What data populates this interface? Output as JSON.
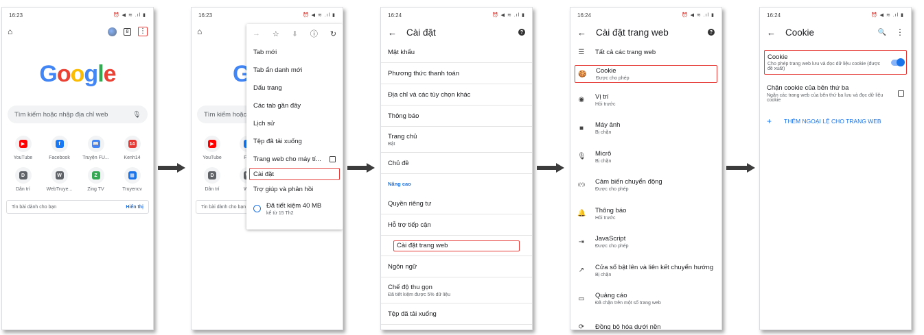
{
  "colors": {
    "accent": "#1a73e8",
    "highlight": "#e53935"
  },
  "screen1": {
    "time": "16:23",
    "status_icons": "⏰ ◀ ≋ .ıl ▮",
    "google_letters": [
      {
        "ch": "G",
        "color": "#4285f4"
      },
      {
        "ch": "o",
        "color": "#ea4335"
      },
      {
        "ch": "o",
        "color": "#fbbc05"
      },
      {
        "ch": "g",
        "color": "#4285f4"
      },
      {
        "ch": "l",
        "color": "#34a853"
      },
      {
        "ch": "e",
        "color": "#ea4335"
      }
    ],
    "tab_count": "8",
    "search_placeholder": "Tìm kiếm hoặc nhập địa chỉ web",
    "tiles": [
      {
        "label": "YouTube",
        "glyph": "▶",
        "color": "#ff0000"
      },
      {
        "label": "Facebook",
        "glyph": "f",
        "color": "#1877f2"
      },
      {
        "label": "Truyện FU...",
        "glyph": "📖",
        "color": "#4285f4"
      },
      {
        "label": "Kenh14",
        "glyph": "14",
        "color": "#e53935"
      },
      {
        "label": "Dân trí",
        "glyph": "D",
        "color": "#5f6368"
      },
      {
        "label": "WebTruye...",
        "glyph": "W",
        "color": "#5f6368"
      },
      {
        "label": "Zing TV",
        "glyph": "Z",
        "color": "#34a853"
      },
      {
        "label": "Truyencv",
        "glyph": "▦",
        "color": "#1a73e8"
      }
    ],
    "feed_label": "Tin bài dành cho bạn",
    "feed_link": "Hiển thị"
  },
  "screen2": {
    "time": "16:23",
    "status_icons": "⏰ ◀ ≋ .ıl ▮",
    "search_placeholder": "Tìm kiếm hoặc nhập",
    "tiles": [
      {
        "label": "YouTube",
        "glyph": "▶",
        "color": "#ff0000"
      },
      {
        "label": "Fac",
        "glyph": "f",
        "color": "#1877f2"
      },
      {
        "label": "Dân trí",
        "glyph": "D",
        "color": "#5f6368"
      },
      {
        "label": "Wel",
        "glyph": "W",
        "color": "#5f6368"
      }
    ],
    "feed_label": "Tin bài dành cho bạn",
    "menu": {
      "items": [
        "Tab mới",
        "Tab ẩn danh mới",
        "Dấu trang",
        "Các tab gần đây",
        "Lịch sử",
        "Tệp đã tải xuống"
      ],
      "desktop_site": "Trang web cho máy tí...",
      "settings": "Cài đặt",
      "help": "Trợ giúp và phản hồi",
      "savings_title": "Đã tiết kiệm 40 MB",
      "savings_sub": "kể từ 15 Th2"
    }
  },
  "screen3": {
    "time": "16:24",
    "status_icons": "⏰ ◀ ≋ .ıl ▮",
    "title": "Cài đặt",
    "rows_top": [
      {
        "t": "Mật khẩu"
      },
      {
        "t": "Phương thức thanh toán"
      },
      {
        "t": "Địa chỉ và các tùy chọn khác"
      },
      {
        "t": "Thông báo"
      },
      {
        "t": "Trang chủ",
        "sub": "Bật"
      },
      {
        "t": "Chủ đề"
      }
    ],
    "section": "Nâng cao",
    "rows_bottom": [
      {
        "t": "Quyền riêng tư"
      },
      {
        "t": "Hỗ trợ tiếp cận"
      }
    ],
    "site_settings": "Cài đặt trang web",
    "rows_end": [
      {
        "t": "Ngôn ngữ"
      },
      {
        "t": "Chế độ thu gọn",
        "sub": "Đã tiết kiệm được 5% dữ liệu"
      },
      {
        "t": "Tệp đã tải xuống"
      }
    ]
  },
  "screen4": {
    "time": "16:24",
    "status_icons": "⏰ ◀ ≋ .ıl ▮",
    "title": "Cài đặt trang web",
    "all_sites": "Tất cả các trang web",
    "cookie": {
      "t": "Cookie",
      "sub": "Được cho phép"
    },
    "rows": [
      {
        "icon": "◉",
        "name": "location-icon",
        "t": "Vị trí",
        "sub": "Hỏi trước"
      },
      {
        "icon": "■",
        "name": "camera-icon",
        "t": "Máy ảnh",
        "sub": "Bị chặn"
      },
      {
        "icon": "🎙",
        "name": "microphone-icon",
        "t": "Micrô",
        "sub": "Bị chặn"
      },
      {
        "icon": "((•))",
        "name": "motion-sensor-icon",
        "t": "Cảm biến chuyển động",
        "sub": "Được cho phép"
      },
      {
        "icon": "🔔",
        "name": "bell-icon",
        "t": "Thông báo",
        "sub": "Hỏi trước"
      },
      {
        "icon": "⇥",
        "name": "javascript-icon",
        "t": "JavaScript",
        "sub": "Được cho phép"
      },
      {
        "icon": "↗",
        "name": "popup-icon",
        "t": "Cửa sổ bật lên và liên kết chuyển hướng",
        "sub": "Bị chặn"
      },
      {
        "icon": "▭",
        "name": "ads-icon",
        "t": "Quảng cáo",
        "sub": "Đã chặn trên một số trang web"
      },
      {
        "icon": "⟳",
        "name": "sync-icon",
        "t": "Đồng bộ hóa dưới nền",
        "sub": ""
      }
    ]
  },
  "screen5": {
    "time": "16:24",
    "status_icons": "⏰ ◀ ≋ .ıl ▮",
    "title": "Cookie",
    "cookie_row": {
      "t": "Cookie",
      "sub": "Cho phép trang web lưu và đọc dữ liệu cookie (được đề xuất)",
      "enabled": true
    },
    "third_party": {
      "t": "Chặn cookie của bên thứ ba",
      "sub": "Ngăn các trang web của bên thứ ba lưu và đọc dữ liệu cookie"
    },
    "add_exception": "THÊM NGOẠI LỆ CHO TRANG WEB"
  }
}
